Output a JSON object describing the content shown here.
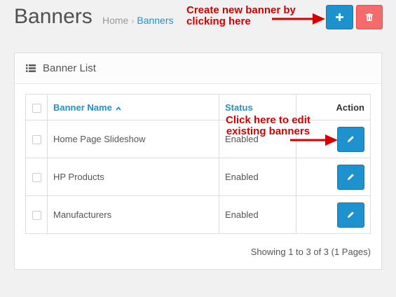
{
  "header": {
    "title": "Banners",
    "breadcrumb": [
      "Home",
      "Banners"
    ],
    "add_icon": "plus-icon",
    "delete_icon": "trash-icon"
  },
  "annotations": {
    "create": [
      "Create new banner by",
      "clicking here"
    ],
    "edit": [
      "Click here to edit",
      "existing banners"
    ],
    "color": "#d40000"
  },
  "panel": {
    "title": "Banner List",
    "title_icon": "list-icon",
    "columns": {
      "name": "Banner Name",
      "status": "Status",
      "action": "Action"
    },
    "rows": [
      {
        "name": "Home Page Slideshow",
        "status": "Enabled"
      },
      {
        "name": "HP Products",
        "status": "Enabled"
      },
      {
        "name": "Manufacturers",
        "status": "Enabled"
      }
    ],
    "pagination": "Showing 1 to 3 of 3 (1 Pages)"
  },
  "colors": {
    "primary": "#1e91cf",
    "danger": "#f56b6b",
    "background": "#f1f1f1"
  }
}
